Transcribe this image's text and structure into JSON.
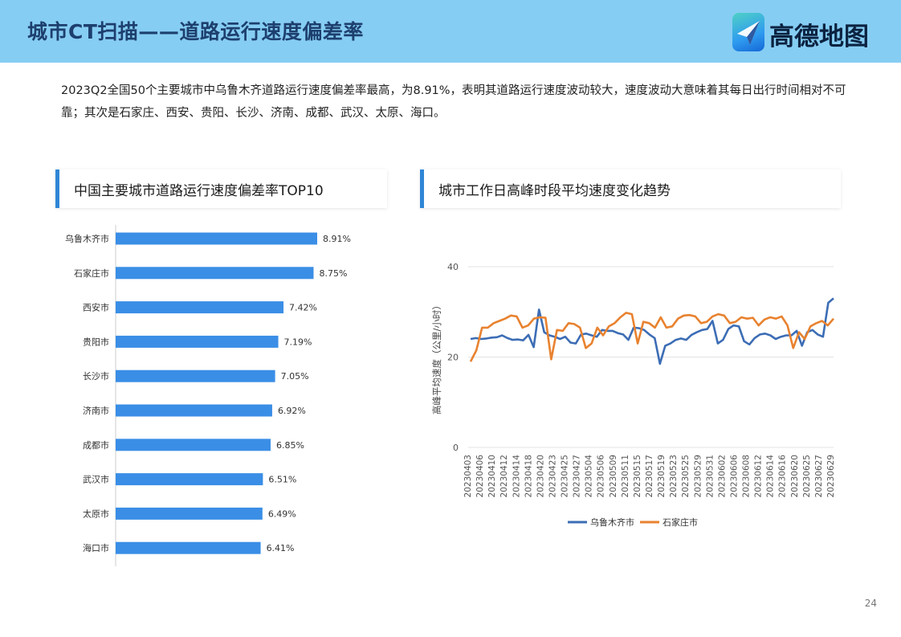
{
  "header": {
    "title": "城市CT扫描——道路运行速度偏差率",
    "logo_text": "高德地图"
  },
  "summary": "2023Q2全国50个主要城市中乌鲁木齐道路运行速度偏差率最高，为8.91%，表明其道路运行速度波动较大，速度波动大意味着其每日出行时间相对不可靠；其次是石家庄、西安、贵阳、长沙、济南、成都、武汉、太原、海口。",
  "left_card": {
    "title": "中国主要城市道路运行速度偏差率TOP10"
  },
  "right_card": {
    "title": "城市工作日高峰时段平均速度变化趋势"
  },
  "page_number": "24",
  "colors": {
    "bar": "#3a8ee6",
    "series1": "#3c6db5",
    "series2": "#e8822f",
    "accent": "#2f86d6"
  },
  "chart_data": [
    {
      "type": "bar",
      "orientation": "horizontal",
      "categories": [
        "乌鲁木齐市",
        "石家庄市",
        "西安市",
        "贵阳市",
        "长沙市",
        "济南市",
        "成都市",
        "武汉市",
        "太原市",
        "海口市"
      ],
      "values": [
        8.91,
        8.75,
        7.42,
        7.19,
        7.05,
        6.92,
        6.85,
        6.51,
        6.49,
        6.41
      ],
      "labels": [
        "8.91%",
        "8.75%",
        "7.42%",
        "7.19%",
        "7.05%",
        "6.92%",
        "6.85%",
        "6.51%",
        "6.49%",
        "6.41%"
      ],
      "xlim": [
        0,
        10
      ]
    },
    {
      "type": "line",
      "ylabel": "高峰平均速度（公里/小时）",
      "ylim": [
        0,
        40
      ],
      "yticks": [
        "0",
        "20",
        "40"
      ],
      "x": [
        "20230403",
        "20230404",
        "20230405",
        "20230406",
        "20230407",
        "20230408",
        "20230409",
        "20230410",
        "20230411",
        "20230412",
        "20230413",
        "20230414",
        "20230415",
        "20230416",
        "20230417",
        "20230418",
        "20230419",
        "20230420",
        "20230421",
        "20230422",
        "20230423",
        "20230424",
        "20230425",
        "20230426",
        "20230427",
        "20230428",
        "20230429",
        "20230430",
        "20230501",
        "20230502",
        "20230503",
        "20230504",
        "20230505",
        "20230506",
        "20230507",
        "20230508",
        "20230509",
        "20230510",
        "20230511",
        "20230512",
        "20230513",
        "20230514",
        "20230515",
        "20230516",
        "20230517",
        "20230518",
        "20230519",
        "20230520",
        "20230521",
        "20230522",
        "20230523",
        "20230524",
        "20230525",
        "20230526",
        "20230527",
        "20230528",
        "20230529",
        "20230530",
        "20230531",
        "20230601",
        "20230602",
        "20230603",
        "20230604",
        "20230605",
        "20230606",
        "20230607",
        "20230608",
        "20230609",
        "20230610",
        "20230611",
        "20230612",
        "20230613",
        "20230614",
        "20230615",
        "20230616",
        "20230617",
        "20230618",
        "20230619",
        "20230620",
        "20230621",
        "20230622",
        "20230623",
        "20230624",
        "20230625",
        "20230626",
        "20230627",
        "20230628",
        "20230629"
      ],
      "x_tick_labels": [
        "20230403",
        "20230406",
        "20230410",
        "20230412",
        "20230414",
        "20230418",
        "20230420",
        "20230423",
        "20230425",
        "20230427",
        "20230504",
        "20230506",
        "20230509",
        "20230511",
        "20230515",
        "20230517",
        "20230519",
        "20230523",
        "20230525",
        "20230529",
        "20230531",
        "20230602",
        "20230606",
        "20230608",
        "20230612",
        "20230614",
        "20230616",
        "20230620",
        "20230625",
        "20230627",
        "20230629"
      ],
      "series": [
        {
          "name": "乌鲁木齐市",
          "values": [
            24.0,
            24.2,
            24.0,
            24.1,
            24.3,
            24.4,
            24.8,
            24.2,
            23.8,
            23.9,
            23.7,
            24.9,
            22.2,
            30.5,
            25.5,
            24.8,
            24.5,
            24.0,
            24.5,
            23.2,
            23.0,
            25.0,
            25.2,
            24.8,
            24.5,
            26.0,
            25.8,
            25.8,
            25.3,
            25.0,
            23.8,
            26.5,
            26.4,
            26.0,
            25.0,
            24.2,
            18.5,
            22.5,
            23.0,
            23.8,
            24.1,
            23.8,
            24.9,
            25.5,
            26.0,
            26.2,
            28.0,
            23.0,
            23.8,
            26.2,
            27.0,
            26.8,
            23.5,
            22.8,
            24.2,
            25.0,
            25.2,
            24.8,
            24.0,
            24.5,
            24.8,
            24.8,
            25.8,
            22.5,
            25.5,
            26.0,
            25.0,
            24.5,
            32.0,
            33.0
          ]
        },
        {
          "name": "石家庄市",
          "values": [
            19.0,
            21.5,
            26.5,
            26.5,
            27.5,
            28.0,
            28.5,
            29.2,
            29.0,
            26.5,
            27.0,
            28.5,
            28.8,
            28.7,
            19.5,
            26.0,
            25.8,
            27.5,
            27.3,
            26.5,
            22.0,
            23.0,
            26.5,
            24.8,
            26.8,
            27.5,
            28.8,
            29.8,
            29.5,
            23.0,
            27.8,
            27.5,
            26.5,
            28.8,
            26.5,
            26.8,
            28.5,
            29.2,
            29.3,
            29.0,
            27.5,
            27.8,
            29.0,
            29.5,
            29.2,
            27.5,
            27.8,
            28.8,
            28.5,
            28.7,
            27.0,
            28.3,
            28.8,
            28.5,
            29.0,
            27.0,
            22.0,
            25.5,
            24.0,
            26.8,
            27.5,
            28.0,
            27.0,
            28.5
          ]
        }
      ],
      "legend": "bottom"
    }
  ]
}
